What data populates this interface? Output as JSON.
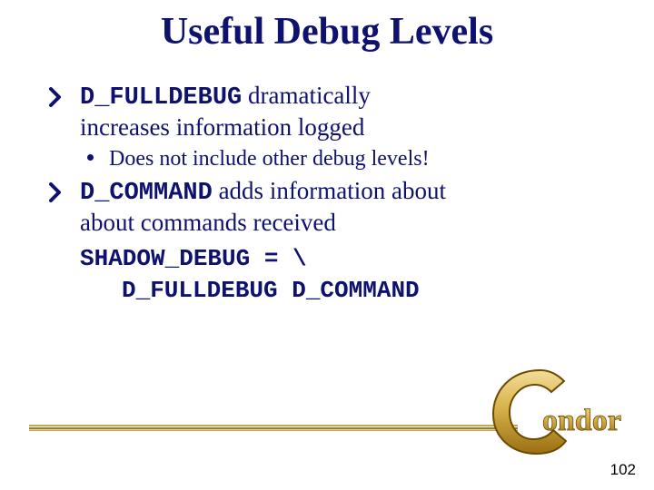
{
  "title": "Useful Debug Levels",
  "bullets": {
    "b1": {
      "code": "D_FULLDEBUG",
      "rest1": " dramatically",
      "rest2": "increases information logged",
      "sub": "Does not include other debug levels!"
    },
    "b2": {
      "code": "D_COMMAND",
      "rest1": " adds information about",
      "rest2": "about commands received"
    }
  },
  "code": {
    "line1": "SHADOW_DEBUG = \\",
    "line2": "D_FULLDEBUG D_COMMAND"
  },
  "logo_text": "ondor",
  "page_number": "102"
}
